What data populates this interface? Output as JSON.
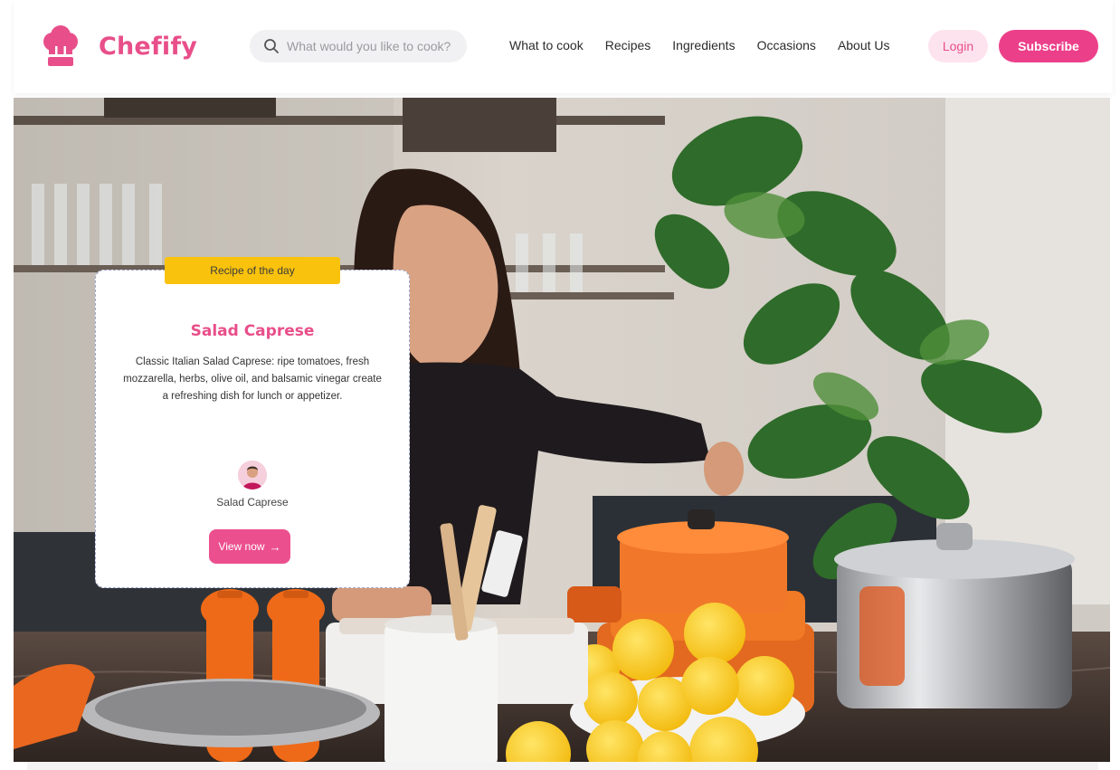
{
  "brand": {
    "name": "Chefify",
    "logo_icon": "chef-hat-icon",
    "accent_color": "#e84f8a"
  },
  "search": {
    "placeholder": "What would you like to cook?",
    "value": "",
    "icon": "search-icon"
  },
  "nav": {
    "items": [
      {
        "label": "What to cook"
      },
      {
        "label": "Recipes"
      },
      {
        "label": "Ingredients"
      },
      {
        "label": "Occasions"
      },
      {
        "label": "About Us"
      }
    ]
  },
  "auth": {
    "login_label": "Login",
    "subscribe_label": "Subscribe"
  },
  "featured": {
    "badge": "Recipe of the day",
    "title": "Salad Caprese",
    "description": "Classic Italian Salad Caprese: ripe tomatoes, fresh mozzarella, herbs, olive oil, and balsamic vinegar create a refreshing dish for lunch or appetizer.",
    "author_name": "Salad Caprese",
    "cta_label": "View now",
    "cta_icon": "arrow-right-icon",
    "badge_color": "#f9c20d"
  }
}
